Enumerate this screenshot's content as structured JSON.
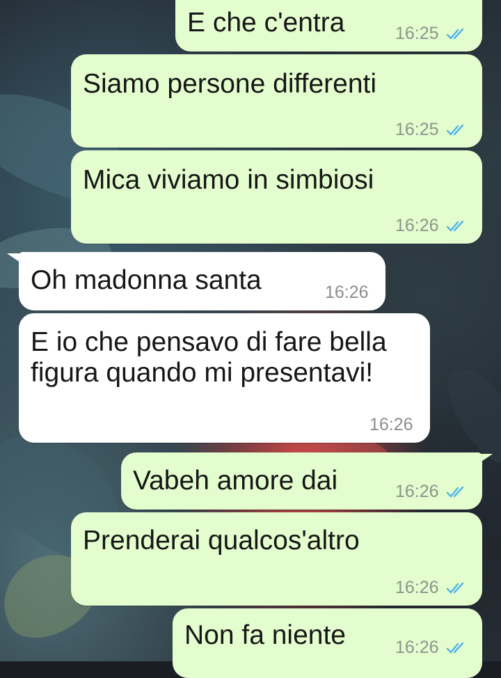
{
  "conversation": {
    "messages": [
      {
        "direction": "outgoing",
        "text": "E che c'entra",
        "time": "16:25",
        "status": "read"
      },
      {
        "direction": "outgoing",
        "text": "Siamo persone differenti",
        "time": "16:25",
        "status": "read"
      },
      {
        "direction": "outgoing",
        "text": "Mica viviamo in simbiosi",
        "time": "16:26",
        "status": "read"
      },
      {
        "direction": "incoming",
        "text": "Oh madonna santa",
        "time": "16:26"
      },
      {
        "direction": "incoming",
        "text": "E io che pensavo di fare bella figura quando mi presentavi!",
        "time": "16:26"
      },
      {
        "direction": "outgoing",
        "text": "Vabeh amore dai",
        "time": "16:26",
        "status": "read"
      },
      {
        "direction": "outgoing",
        "text": "Prenderai qualcos'altro",
        "time": "16:26",
        "status": "read"
      },
      {
        "direction": "outgoing",
        "text": "Non fa niente",
        "time": "16:26",
        "status": "read"
      }
    ]
  },
  "colors": {
    "outgoing_bubble": "#e4fdce",
    "incoming_bubble": "#ffffff",
    "read_tick": "#4fb3e8"
  },
  "icons": {
    "read_receipt": "double-check-icon"
  }
}
